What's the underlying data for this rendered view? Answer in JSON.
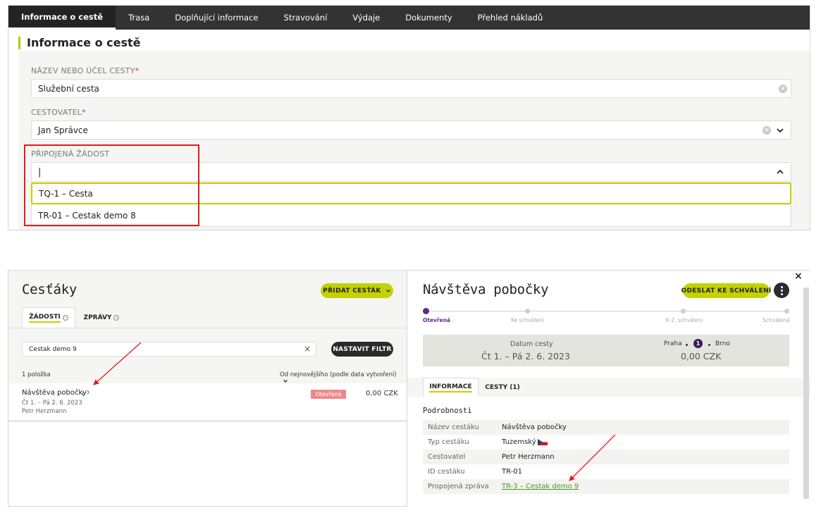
{
  "top": {
    "tabs": [
      "Informace o cestě",
      "Trasa",
      "Doplňující informace",
      "Stravování",
      "Výdaje",
      "Dokumenty",
      "Přehled nákladů"
    ],
    "section_title": "Informace o cestě",
    "purpose": {
      "label": "NÁZEV NEBO ÚČEL CESTY",
      "required": "*",
      "value": "Služební cesta"
    },
    "traveler": {
      "label": "CESTOVATEL",
      "required": "*",
      "value": "Jan Správce"
    },
    "attached": {
      "label": "PŘIPOJENÁ ŽÁDOST",
      "value": "|",
      "options": [
        "TQ-1 – Cesta",
        "TR-01 – Cestak demo 8"
      ]
    }
  },
  "left": {
    "title": "Cesťáky",
    "add_button": "PŘIDAT CESŤÁK",
    "tab_requests": "ŽÁDOSTI",
    "tab_reports": "ZPRÁVY",
    "search_value": "Cestak demo 9",
    "filter_button": "NASTAVIT FILTR",
    "count": "1 položka",
    "sort": "Od nejnovějšího (podle data vytvoření)",
    "item": {
      "title": "Návštěva pobočky",
      "dates": "Čt 1. – Pá 2. 6. 2023",
      "person": "Petr Herzmann",
      "status": "Otevřená",
      "amount": "0,00 CZK"
    }
  },
  "right": {
    "title": "Návštěva pobočky",
    "send_button": "ODESLAT KE SCHVÁLENÍ",
    "steps": [
      "Otevřená",
      "Ke schválení",
      "K 2. schválení",
      "Schválená"
    ],
    "date_label": "Datum cesty",
    "date_value": "Čt 1. – Pá 2. 6. 2023",
    "route_from": "Praha",
    "route_count": "1",
    "route_to": "Brno",
    "route_amount": "0,00 CZK",
    "tab_info": "INFORMACE",
    "tab_trips": "CESTY (1)",
    "details_title": "Podrobnosti",
    "details": [
      {
        "k": "Název cestáku",
        "v": "Návštěva pobočky"
      },
      {
        "k": "Typ cestáku",
        "v": "Tuzemský"
      },
      {
        "k": "Cestovatel",
        "v": "Petr Herzmann"
      },
      {
        "k": "ID cestáku",
        "v": "TR-01"
      },
      {
        "k": "Propojená zpráva",
        "v": "TR-3 – Cestak demo 9"
      }
    ]
  },
  "colors": {
    "accent": "#c3d200",
    "dark": "#333333",
    "annotation": "#e31b1b",
    "link": "#4a9a22",
    "badge": "#ec8a8a",
    "step_active": "#5b2a86"
  }
}
